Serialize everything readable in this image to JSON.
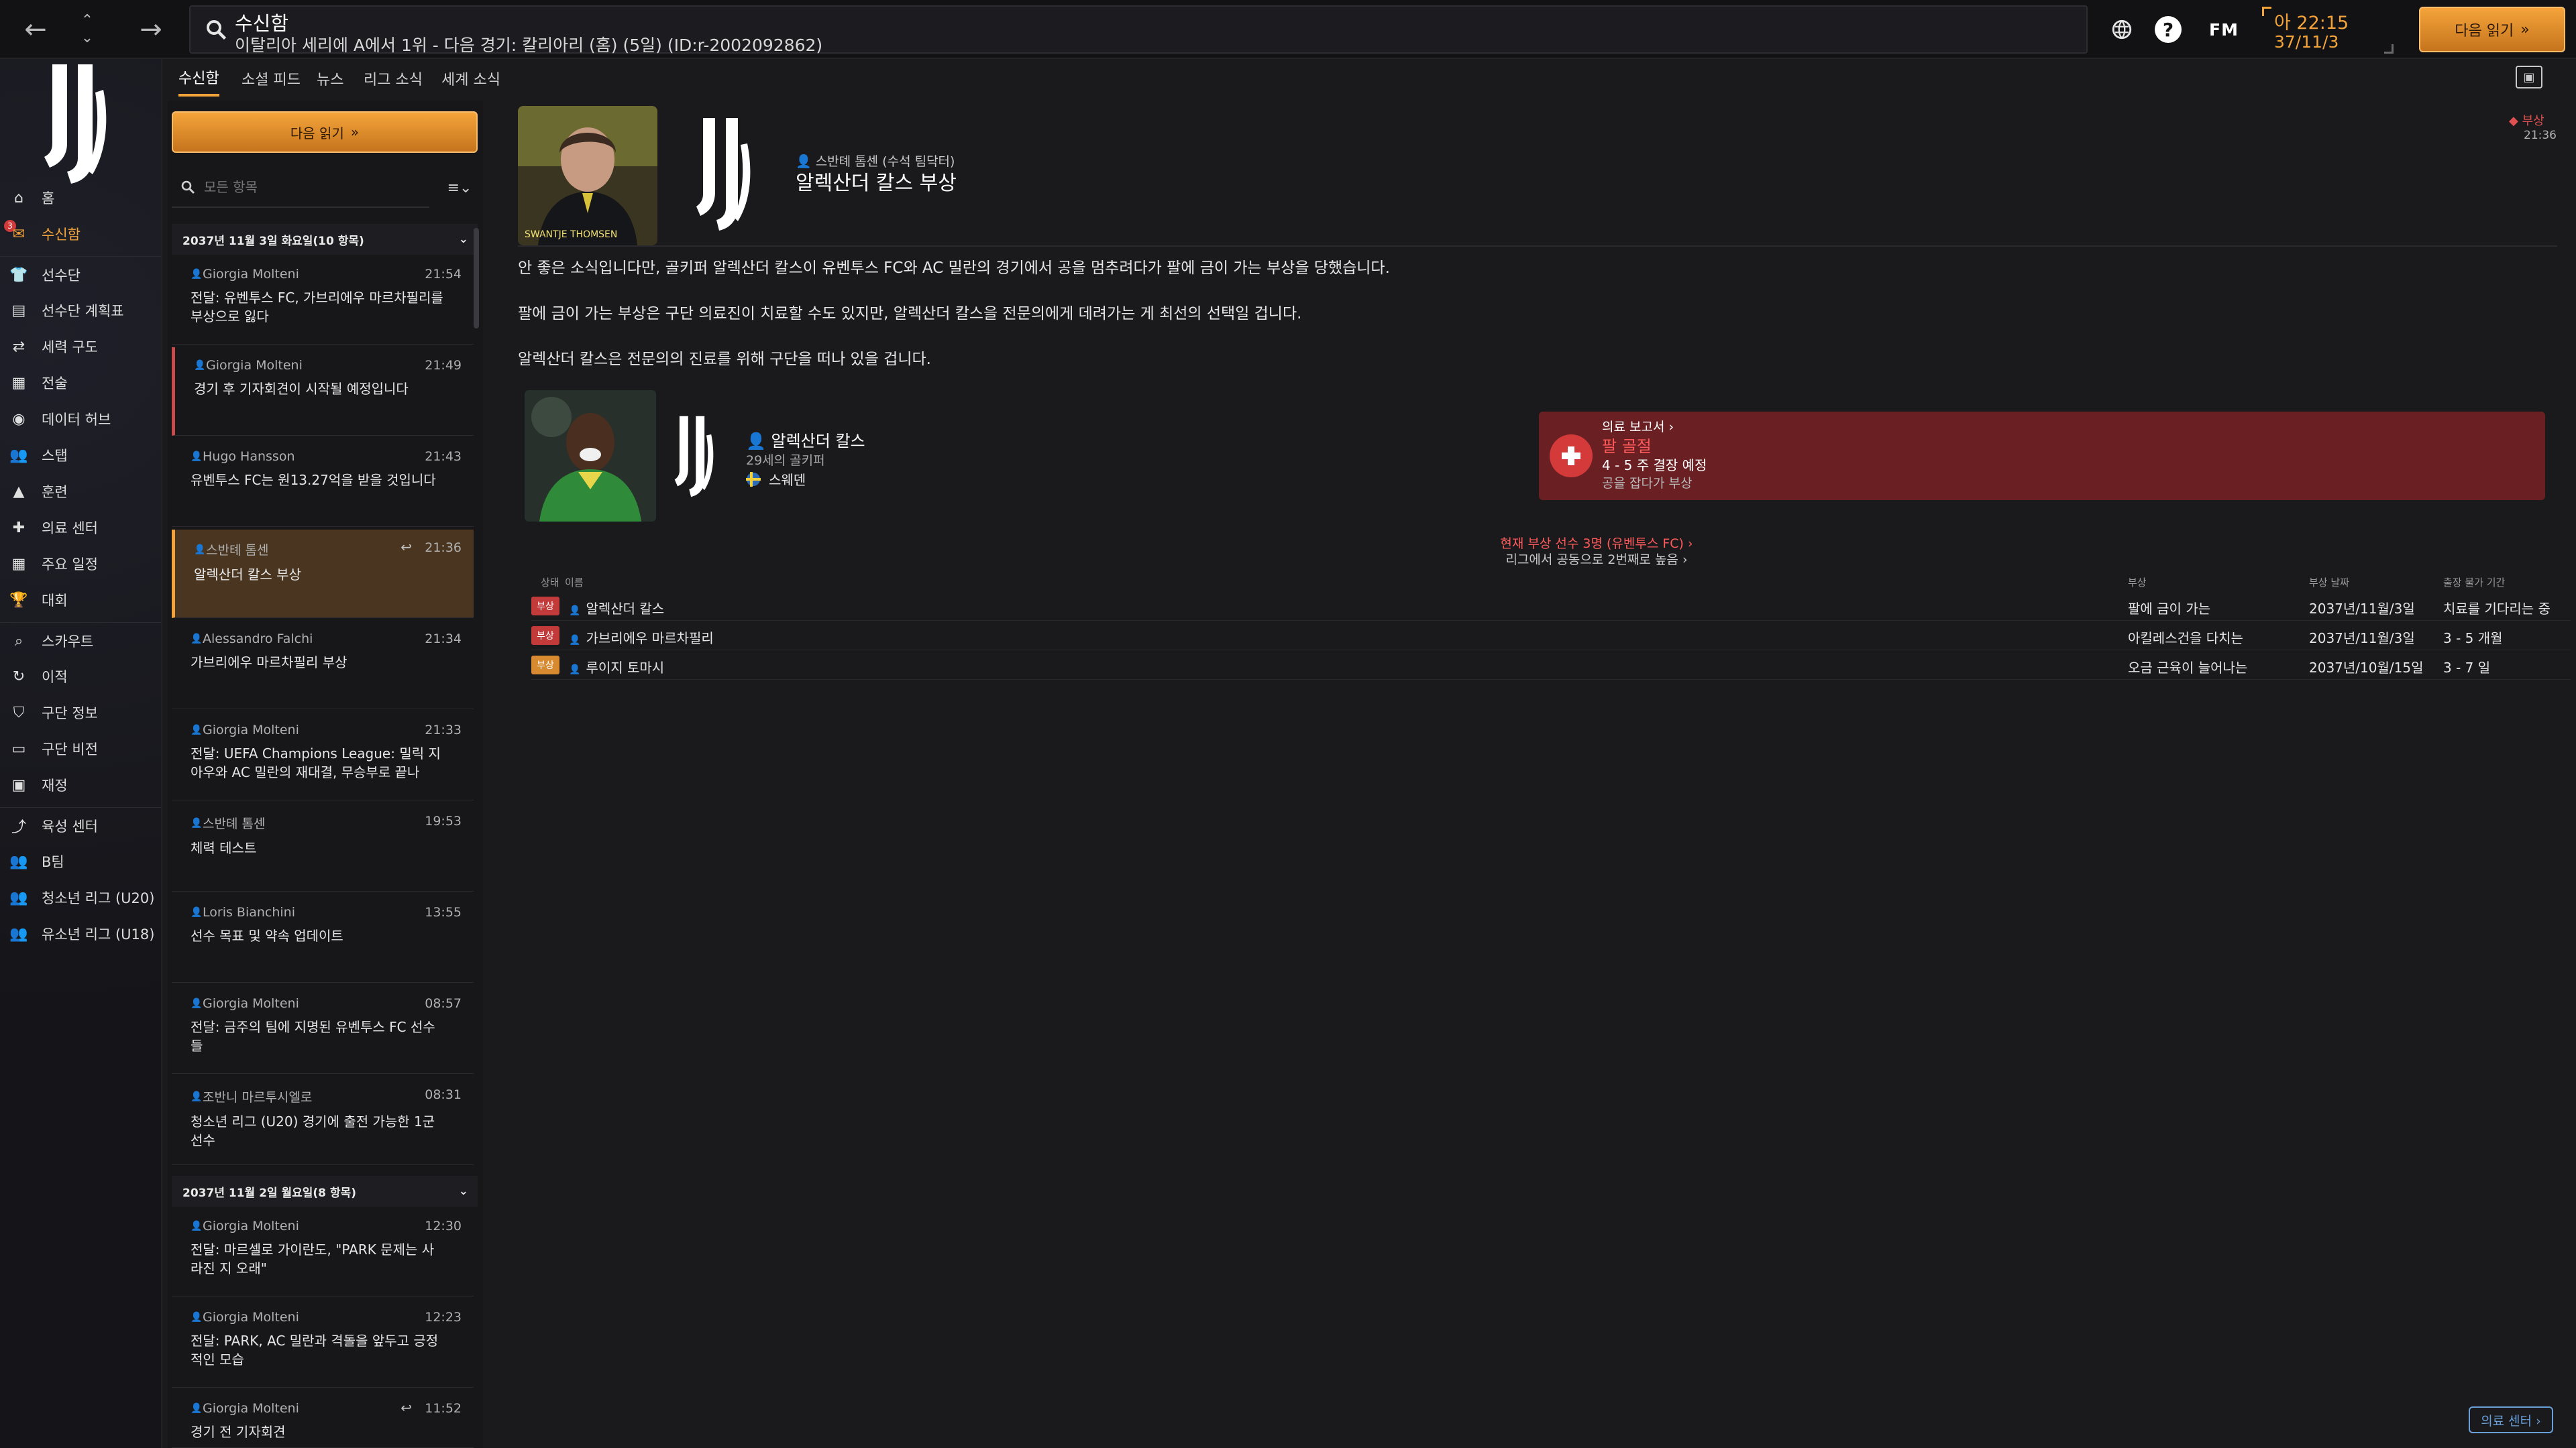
{
  "topbar": {
    "title": "수신함",
    "subtitle": "이탈리아 세리에 A에서 1위 - 다음 경기: 칼리아리 (홈) (5일) (ID:r-2002092862)",
    "fm_logo": "FM",
    "clock_time": "아 22:15",
    "clock_date": "37/11/3",
    "continue_label": "다음 읽기",
    "help_label": "?"
  },
  "sidebar": {
    "inbox_badge": "3",
    "items": [
      {
        "label": "홈",
        "icon": "home-icon"
      },
      {
        "label": "수신함",
        "icon": "inbox-icon"
      },
      {
        "label": "선수단",
        "icon": "shirt-icon"
      },
      {
        "label": "선수단 계획표",
        "icon": "clipboard-icon"
      },
      {
        "label": "세력 구도",
        "icon": "dynamics-icon"
      },
      {
        "label": "전술",
        "icon": "tactics-icon"
      },
      {
        "label": "데이터 허브",
        "icon": "data-hub-icon"
      },
      {
        "label": "스탭",
        "icon": "staff-icon"
      },
      {
        "label": "훈련",
        "icon": "training-icon"
      },
      {
        "label": "의료 센터",
        "icon": "medical-icon"
      },
      {
        "label": "주요 일정",
        "icon": "calendar-icon"
      },
      {
        "label": "대회",
        "icon": "trophy-icon"
      },
      {
        "label": "스카우트",
        "icon": "scout-icon"
      },
      {
        "label": "이적",
        "icon": "transfer-icon"
      },
      {
        "label": "구단 정보",
        "icon": "shield-icon"
      },
      {
        "label": "구단 비전",
        "icon": "vision-icon"
      },
      {
        "label": "재정",
        "icon": "finance-icon"
      },
      {
        "label": "육성 센터",
        "icon": "development-icon"
      },
      {
        "label": "B팀",
        "icon": "team-icon"
      },
      {
        "label": "청소년 리그 (U20)",
        "icon": "team-icon"
      },
      {
        "label": "유소년 리그 (U18)",
        "icon": "team-icon"
      }
    ]
  },
  "tabs": {
    "inbox": "수신함",
    "social": "소셜 피드",
    "news": "뉴스",
    "league": "리그 소식",
    "world": "세계 소식"
  },
  "inbox": {
    "continue_label": "다음 읽기",
    "search_placeholder": "모든 항목",
    "group1": "2037년 11월 3일 화요일(10 항목)",
    "group2": "2037년 11월 2일 월요일(8 항목)",
    "messages": [
      {
        "sender": "Giorgia Molteni",
        "time": "21:54",
        "subject": "전달: 유벤투스 FC, 가브리에우 마르차필리를 부상으로 잃다"
      },
      {
        "sender": "Giorgia Molteni",
        "time": "21:49",
        "subject": "경기 후 기자회견이 시작될 예정입니다"
      },
      {
        "sender": "Hugo Hansson",
        "time": "21:43",
        "subject": "유벤투스 FC는 원13.27억을 받을 것입니다"
      },
      {
        "sender": "스반톄 톰센",
        "time": "21:36",
        "subject": "알렉산더 칼스 부상"
      },
      {
        "sender": "Alessandro Falchi",
        "time": "21:34",
        "subject": "가브리에우 마르차필리 부상"
      },
      {
        "sender": "Giorgia Molteni",
        "time": "21:33",
        "subject": "전달: UEFA Champions League: 밀릭 지아우와 AC 밀란의 재대결, 무승부로 끝나"
      },
      {
        "sender": "스반톄 톰센",
        "time": "19:53",
        "subject": "체력 테스트"
      },
      {
        "sender": "Loris Bianchini",
        "time": "13:55",
        "subject": "선수 목표 및 약속 업데이트"
      },
      {
        "sender": "Giorgia Molteni",
        "time": "08:57",
        "subject": "전달: 금주의 팀에 지명된 유벤투스 FC 선수들"
      },
      {
        "sender": "조반니 마르투시엘로",
        "time": "08:31",
        "subject": "청소년 리그 (U20) 경기에 출전 가능한 1군 선수"
      },
      {
        "sender": "Giorgia Molteni",
        "time": "12:30",
        "subject": "전달: 마르셀로 가이란도, \"PARK 문제는 사라진 지 오래\""
      },
      {
        "sender": "Giorgia Molteni",
        "time": "12:23",
        "subject": "전달: PARK, AC 밀란과 격돌을 앞두고 긍정적인 모습"
      },
      {
        "sender": "Giorgia Molteni",
        "time": "11:52",
        "subject": "경기 전 기자회견"
      }
    ]
  },
  "message": {
    "from": "스반톄 톰센 (수석 팀닥터)",
    "headline": "알렉산더 칼스 부상",
    "tag": "부상",
    "time": "21:36",
    "photo_caption": "SWANTJE THOMSEN",
    "para1": "안 좋은 소식입니다만, 골키퍼 알렉산더 칼스이 유벤투스 FC와 AC 밀란의 경기에서 공을 멈추려다가 팔에 금이 가는 부상을 당했습니다.",
    "para2": "팔에 금이 가는 부상은 구단 의료진이 치료할 수도 있지만, 알렉산더 칼스을 전문의에게 데려가는 게 최선의 선택일 겁니다.",
    "para3": "알렉산더 칼스은 전문의의 진료를 위해 구단을 떠나 있을 겁니다."
  },
  "player": {
    "name": "알렉산더 칼스",
    "meta": "29세의 골키퍼",
    "nation": "스웨덴"
  },
  "medical": {
    "report": "의료 보고서 ›",
    "injury": "팔 골절",
    "duration": "4 - 5 주 결장 예정",
    "note": "공을 잡다가 부상",
    "injured_count": "현재 부상 선수 3명 (유벤투스 FC) ›",
    "league_rank": "리그에서 공동으로 2번째로 높음 ›"
  },
  "injury_table": {
    "headers": {
      "status": "상태",
      "name": "이름",
      "injury": "부상",
      "date": "부상 날짜",
      "absence": "출장 불가 기간"
    },
    "rows": [
      {
        "status": "부상",
        "name": "알렉산더 칼스",
        "injury": "팔에 금이 가는",
        "date": "2037년/11월/3일",
        "absence": "치료를 기다리는 중"
      },
      {
        "status": "부상",
        "name": "가브리에우 마르차필리",
        "injury": "아킬레스건을 다치는",
        "date": "2037년/11월/3일",
        "absence": "3 - 5 개월"
      },
      {
        "status": "부상",
        "name": "루이지 토마시",
        "injury": "오금 근육이 늘어나는",
        "date": "2037년/10월/15일",
        "absence": "3 - 7 일"
      }
    ]
  },
  "footer": {
    "medical_center_btn": "의료 센터 ›"
  },
  "colors": {
    "accent": "#f2a33a",
    "injury_red": "#c23a3a",
    "medical_card": "#6a1f23",
    "link_blue": "#6aa0d8"
  }
}
